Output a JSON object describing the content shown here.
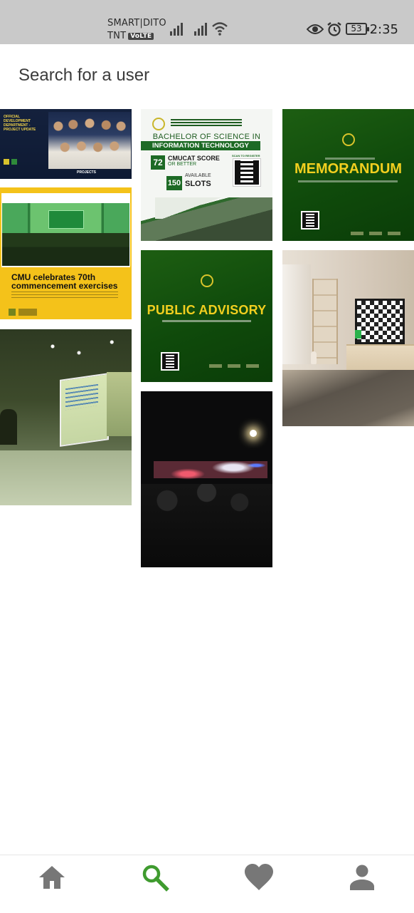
{
  "status_bar": {
    "carrier_line1": "SMART|DITO",
    "carrier_line2": "TNT",
    "volte": "VoLTE",
    "battery": "53",
    "time": "2:35"
  },
  "search": {
    "placeholder": "Search for a user"
  },
  "posts": [
    {
      "id": "post-1",
      "headline": "OFFICIAL DEVELOPMENT DEPARTMENT - PROJECT UPDATE",
      "footer": "PROJECTS"
    },
    {
      "id": "post-2",
      "headline": "BACHELOR OF SCIENCE IN",
      "subheadline": "INFORMATION TECHNOLOGY",
      "score": "72",
      "score_label": "CMUCAT SCORE",
      "score_sub": "OR BETTER",
      "slots": "150",
      "slots_label1": "AVAILABLE",
      "slots_label2": "SLOTS",
      "scan": "SCAN TO REGISTER"
    },
    {
      "id": "post-3",
      "headline": "MEMORANDUM"
    },
    {
      "id": "post-4",
      "headline1": "CMU celebrates 70th",
      "headline2": "commencement exercises"
    },
    {
      "id": "post-5",
      "headline": "PUBLIC ADVISORY"
    },
    {
      "id": "post-6",
      "description": "room with checkered tv"
    },
    {
      "id": "post-7",
      "description": "projector screen in hall"
    },
    {
      "id": "post-8",
      "description": "night concert crowd"
    }
  ],
  "nav": {
    "items": [
      {
        "name": "home",
        "icon": "home-icon",
        "active": false
      },
      {
        "name": "search",
        "icon": "search-icon",
        "active": true
      },
      {
        "name": "favorites",
        "icon": "heart-icon",
        "active": false
      },
      {
        "name": "profile",
        "icon": "person-icon",
        "active": false
      }
    ],
    "active_color": "#3f9b2f",
    "inactive_color": "#777777"
  }
}
